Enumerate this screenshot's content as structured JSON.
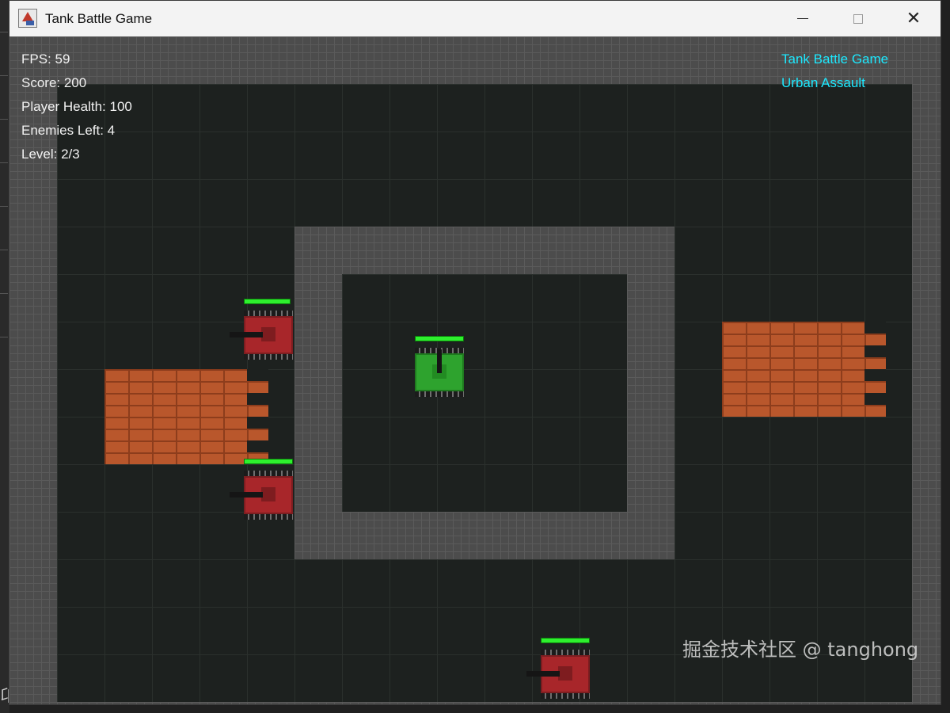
{
  "window": {
    "title": "Tank Battle Game"
  },
  "hud": {
    "fps": "FPS: 59",
    "score": "Score: 200",
    "player_health": "Player Health: 100",
    "enemies_left": "Enemies Left: 4",
    "level": "Level: 2/3",
    "game_title": "Tank Battle Game",
    "stage_name": "Urban Assault"
  },
  "tanks": [
    {
      "team": "enemy",
      "health_fraction": 0.95,
      "facing": "left"
    },
    {
      "team": "enemy",
      "health_fraction": 1.0,
      "facing": "left"
    },
    {
      "team": "enemy",
      "health_fraction": 1.0,
      "facing": "left"
    },
    {
      "team": "player",
      "health_fraction": 1.0,
      "facing": "up"
    }
  ],
  "colors": {
    "hud_text": "#f2f2f2",
    "hud_accent": "#1de9ff",
    "enemy_tank": "#a8262a",
    "player_tank": "#2ea32e",
    "health_bar": "#2ef02e",
    "brick": "#b9572c",
    "stone": "#4c4c4c"
  },
  "watermark": "掘金技术社区 @ tanghong",
  "icons": [
    "app-icon",
    "minimize-icon",
    "maximize-icon",
    "close-icon"
  ]
}
